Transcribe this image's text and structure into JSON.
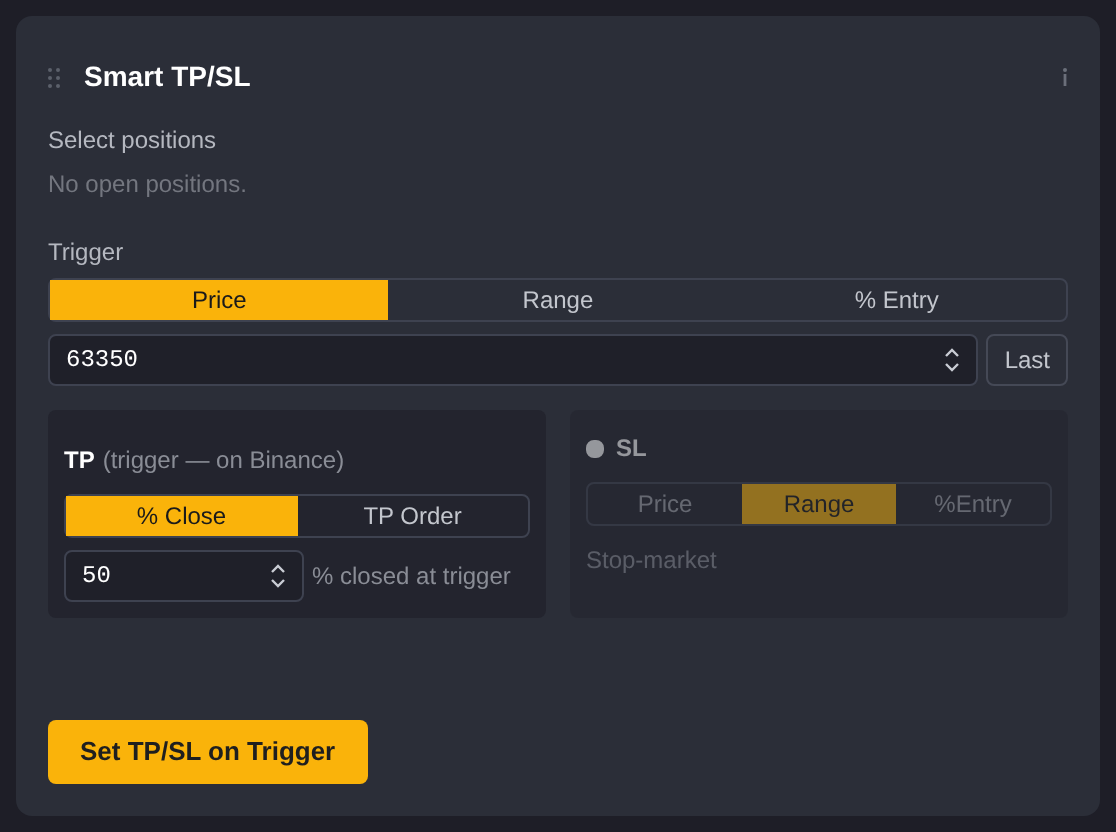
{
  "title": "Smart TP/SL",
  "positions": {
    "label": "Select positions",
    "empty": "No open positions."
  },
  "trigger": {
    "label": "Trigger",
    "tabs": [
      {
        "label": "Price",
        "selected": true
      },
      {
        "label": "Range",
        "selected": false
      },
      {
        "label": "% Entry",
        "selected": false
      }
    ],
    "value": "63350",
    "button": "Last"
  },
  "tp": {
    "label": "TP",
    "note": "(trigger — on Binance)",
    "tabs": [
      {
        "label": "% Close",
        "selected": true
      },
      {
        "label": "TP Order",
        "selected": false
      }
    ],
    "value": "50",
    "suffix": "% closed at trigger"
  },
  "sl": {
    "label": "SL",
    "checked": false,
    "disabled": true,
    "tabs": [
      {
        "label": "Price",
        "selected": false
      },
      {
        "label": "Range",
        "selected": true
      },
      {
        "label": "%Entry",
        "selected": false
      }
    ],
    "note": "Stop-market"
  },
  "submit": "Set TP/SL on Trigger"
}
